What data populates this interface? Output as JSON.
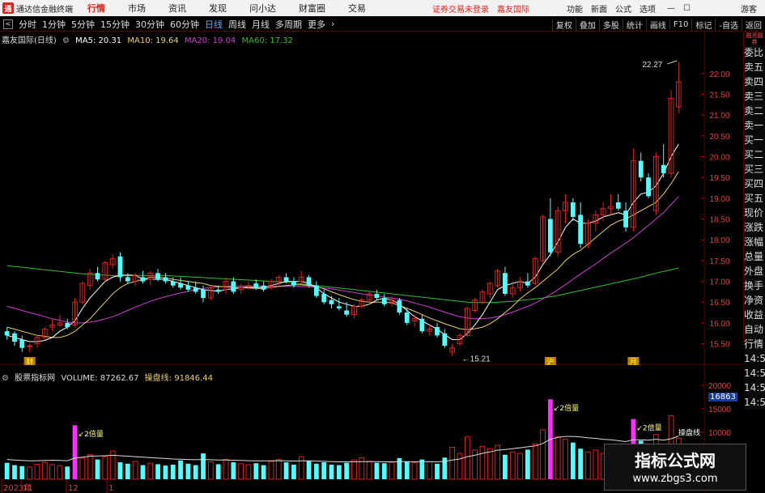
{
  "menubar": {
    "logo_text": "通",
    "app_title": "通达信金融终端",
    "menus": [
      "行情",
      "市场",
      "资讯",
      "发现",
      "问小达",
      "财富圈",
      "交易"
    ],
    "active_menu": "行情",
    "notice": "证券交易未登录",
    "stock_label": "嘉友国际",
    "right_menus": [
      "功能",
      "新面",
      "公式",
      "选项"
    ],
    "guest": "游客"
  },
  "toolbar": {
    "periods": [
      "分时",
      "1分钟",
      "5分钟",
      "15分钟",
      "30分钟",
      "60分钟",
      "日线",
      "周线",
      "月线",
      "多周期",
      "更多"
    ],
    "active_period": "日线",
    "right_buttons": [
      "复权",
      "叠加",
      "多股",
      "统计",
      "画线",
      "F10",
      "标记",
      "-自选",
      "返回"
    ]
  },
  "info": {
    "stock": "嘉友国际(日线)",
    "ma5": "MA5: 20.31",
    "ma10": "MA10: 19.64",
    "ma20": "MA20: 19.04",
    "ma60": "MA60: 17.32"
  },
  "colors": {
    "up": "#e02020",
    "down": "#54ffff",
    "ma5": "#ffffff",
    "ma10": "#e8d070",
    "ma20": "#d040d0",
    "ma60": "#30c030"
  },
  "price_axis": {
    "ticks": [
      "22.00",
      "21.50",
      "21.00",
      "20.50",
      "20.00",
      "19.50",
      "19.00",
      "18.50",
      "18.00",
      "17.50",
      "17.00",
      "16.50",
      "16.00",
      "15.50"
    ]
  },
  "annotations": {
    "high": "22.27",
    "low": "15.21",
    "marker_cai": "财",
    "marker_hu": "沪",
    "marker_yue": "月"
  },
  "side_panel": {
    "top_note": "融资融券",
    "items": [
      "委比",
      "卖五",
      "卖四",
      "卖三",
      "卖二",
      "卖一",
      "买一",
      "买二",
      "买三",
      "买四",
      "买五",
      "现价",
      "涨跌",
      "涨幅",
      "总量",
      "外盘",
      "换手",
      "净资",
      "收益",
      "自动",
      "行情",
      "14:5",
      "14:5",
      "14:5",
      "14:5"
    ]
  },
  "volume": {
    "indicator": "股票指标网",
    "volume": "VOLUME: 87262.67",
    "line": "操盘线: 91846.44",
    "current": "16863",
    "ticks": [
      "20000",
      "15000",
      "10000"
    ],
    "label_2x": "2倍量",
    "label_op": "操盘线"
  },
  "date_axis": {
    "labels": [
      "2023年",
      "11",
      "12",
      "1"
    ]
  },
  "watermark": {
    "line1": "指标公式网",
    "line2": "www.zbgs3.com"
  },
  "chart_data": {
    "type": "candlestick",
    "ylim": [
      15.2,
      22.6
    ],
    "candles": [
      [
        15.8,
        15.9,
        15.6,
        15.7
      ],
      [
        15.75,
        15.8,
        15.45,
        15.55
      ],
      [
        15.6,
        15.7,
        15.3,
        15.4
      ],
      [
        15.45,
        15.5,
        15.3,
        15.45
      ],
      [
        15.5,
        15.7,
        15.4,
        15.65
      ],
      [
        15.65,
        15.9,
        15.6,
        15.85
      ],
      [
        15.9,
        16.1,
        15.8,
        15.95
      ],
      [
        15.95,
        16.2,
        15.9,
        16.0
      ],
      [
        16.0,
        16.1,
        15.85,
        15.9
      ],
      [
        15.95,
        16.6,
        15.9,
        16.5
      ],
      [
        16.5,
        17.0,
        16.45,
        16.95
      ],
      [
        16.9,
        17.3,
        16.8,
        17.2
      ],
      [
        17.2,
        17.35,
        17.0,
        17.05
      ],
      [
        17.05,
        17.5,
        17.0,
        17.45
      ],
      [
        17.4,
        17.65,
        17.3,
        17.55
      ],
      [
        17.6,
        17.7,
        17.0,
        17.1
      ],
      [
        17.1,
        17.2,
        16.95,
        17.0
      ],
      [
        17.0,
        17.2,
        16.9,
        17.15
      ],
      [
        17.1,
        17.25,
        16.95,
        17.0
      ],
      [
        17.05,
        17.25,
        16.9,
        17.2
      ],
      [
        17.2,
        17.3,
        17.0,
        17.05
      ],
      [
        17.1,
        17.2,
        16.95,
        17.0
      ],
      [
        17.0,
        17.1,
        16.85,
        16.9
      ],
      [
        16.95,
        17.1,
        16.8,
        16.85
      ],
      [
        16.9,
        17.0,
        16.75,
        16.8
      ],
      [
        16.85,
        17.0,
        16.7,
        16.75
      ],
      [
        16.8,
        16.9,
        16.5,
        16.6
      ],
      [
        16.6,
        16.9,
        16.55,
        16.85
      ],
      [
        16.8,
        16.9,
        16.7,
        16.75
      ],
      [
        16.8,
        17.1,
        16.7,
        17.0
      ],
      [
        17.0,
        17.1,
        16.7,
        16.75
      ],
      [
        16.8,
        16.95,
        16.7,
        16.85
      ],
      [
        16.9,
        17.0,
        16.8,
        16.9
      ],
      [
        16.95,
        17.05,
        16.8,
        16.85
      ],
      [
        16.9,
        17.0,
        16.75,
        16.8
      ],
      [
        16.85,
        17.05,
        16.8,
        17.0
      ],
      [
        17.0,
        17.15,
        16.9,
        17.1
      ],
      [
        17.1,
        17.2,
        16.95,
        17.0
      ],
      [
        17.0,
        17.1,
        16.85,
        16.9
      ],
      [
        17.0,
        17.25,
        16.95,
        17.1
      ],
      [
        17.1,
        17.15,
        16.85,
        16.9
      ],
      [
        16.9,
        17.0,
        16.6,
        16.65
      ],
      [
        16.7,
        16.8,
        16.45,
        16.5
      ],
      [
        16.55,
        16.65,
        16.35,
        16.45
      ],
      [
        16.4,
        16.6,
        16.3,
        16.35
      ],
      [
        16.3,
        16.5,
        16.15,
        16.2
      ],
      [
        16.2,
        16.45,
        16.1,
        16.4
      ],
      [
        16.4,
        16.6,
        16.35,
        16.55
      ],
      [
        16.55,
        16.75,
        16.5,
        16.7
      ],
      [
        16.7,
        16.8,
        16.55,
        16.6
      ],
      [
        16.6,
        16.7,
        16.4,
        16.45
      ],
      [
        16.5,
        16.65,
        16.4,
        16.55
      ],
      [
        16.55,
        16.6,
        16.2,
        16.25
      ],
      [
        16.25,
        16.35,
        15.95,
        16.0
      ],
      [
        16.05,
        16.2,
        15.9,
        16.1
      ],
      [
        16.1,
        16.2,
        15.75,
        15.8
      ],
      [
        15.8,
        15.95,
        15.7,
        15.85
      ],
      [
        15.9,
        16.0,
        15.65,
        15.7
      ],
      [
        15.75,
        15.85,
        15.4,
        15.45
      ],
      [
        15.3,
        15.5,
        15.21,
        15.4
      ],
      [
        15.5,
        15.75,
        15.45,
        15.7
      ],
      [
        15.7,
        16.4,
        15.65,
        16.35
      ],
      [
        16.3,
        16.6,
        16.25,
        16.55
      ],
      [
        16.5,
        16.8,
        16.45,
        16.75
      ],
      [
        16.7,
        17.0,
        16.6,
        16.95
      ],
      [
        16.9,
        17.3,
        16.85,
        17.25
      ],
      [
        17.2,
        17.35,
        16.65,
        16.7
      ],
      [
        16.7,
        17.0,
        16.6,
        16.85
      ],
      [
        16.85,
        17.1,
        16.75,
        17.0
      ],
      [
        17.0,
        17.2,
        16.85,
        16.9
      ],
      [
        16.95,
        17.6,
        16.9,
        17.55
      ],
      [
        17.5,
        18.6,
        17.45,
        18.55
      ],
      [
        18.5,
        19.0,
        17.6,
        17.7
      ],
      [
        17.7,
        18.8,
        17.6,
        18.7
      ],
      [
        18.7,
        19.1,
        18.4,
        18.9
      ],
      [
        18.9,
        19.0,
        18.45,
        18.55
      ],
      [
        18.6,
        18.9,
        17.8,
        17.9
      ],
      [
        17.9,
        18.5,
        17.8,
        18.4
      ],
      [
        18.4,
        18.7,
        18.2,
        18.6
      ],
      [
        18.6,
        18.9,
        18.45,
        18.75
      ],
      [
        18.75,
        19.1,
        18.6,
        18.8
      ],
      [
        18.9,
        19.1,
        18.7,
        18.75
      ],
      [
        18.7,
        18.9,
        18.2,
        18.3
      ],
      [
        18.3,
        20.2,
        18.2,
        19.9
      ],
      [
        19.9,
        20.1,
        19.4,
        19.5
      ],
      [
        19.5,
        19.6,
        19.0,
        19.05
      ],
      [
        18.7,
        20.1,
        18.6,
        20.0
      ],
      [
        19.8,
        20.3,
        19.5,
        19.6
      ],
      [
        19.6,
        21.6,
        19.5,
        21.4
      ],
      [
        21.2,
        22.27,
        21.05,
        21.8
      ]
    ],
    "ma5": [
      15.7,
      15.65,
      15.6,
      15.55,
      15.55,
      15.58,
      15.65,
      15.8,
      15.9,
      16.05,
      16.35,
      16.6,
      16.8,
      17.0,
      17.1,
      17.15,
      17.15,
      17.15,
      17.05,
      17.05,
      17.05,
      17.05,
      17.0,
      16.95,
      16.9,
      16.85,
      16.8,
      16.78,
      16.76,
      16.8,
      16.82,
      16.85,
      16.86,
      16.85,
      16.85,
      16.9,
      16.95,
      17.0,
      17.0,
      17.0,
      16.95,
      16.85,
      16.7,
      16.6,
      16.5,
      16.45,
      16.4,
      16.4,
      16.45,
      16.55,
      16.6,
      16.55,
      16.45,
      16.3,
      16.15,
      16.05,
      15.95,
      15.85,
      15.72,
      15.6,
      15.6,
      15.75,
      15.95,
      16.2,
      16.5,
      16.8,
      16.9,
      16.95,
      17.0,
      16.95,
      17.1,
      17.4,
      17.65,
      17.95,
      18.3,
      18.5,
      18.4,
      18.4,
      18.45,
      18.55,
      18.6,
      18.65,
      18.6,
      18.9,
      19.1,
      19.15,
      19.3,
      19.6,
      20.0,
      20.3
    ],
    "ma10": [
      15.9,
      15.85,
      15.8,
      15.75,
      15.7,
      15.68,
      15.65,
      15.65,
      15.7,
      15.8,
      15.95,
      16.1,
      16.3,
      16.5,
      16.7,
      16.85,
      16.95,
      17.0,
      17.05,
      17.1,
      17.1,
      17.08,
      17.05,
      17.02,
      17.0,
      16.97,
      16.95,
      16.9,
      16.88,
      16.87,
      16.85,
      16.85,
      16.84,
      16.83,
      16.83,
      16.85,
      16.88,
      16.9,
      16.92,
      16.92,
      16.9,
      16.88,
      16.82,
      16.75,
      16.68,
      16.62,
      16.56,
      16.52,
      16.5,
      16.5,
      16.5,
      16.48,
      16.42,
      16.35,
      16.28,
      16.2,
      16.12,
      16.05,
      15.98,
      15.92,
      15.86,
      15.84,
      15.86,
      15.9,
      15.98,
      16.1,
      16.25,
      16.4,
      16.58,
      16.72,
      16.85,
      17.0,
      17.15,
      17.3,
      17.5,
      17.65,
      17.75,
      17.9,
      18.05,
      18.2,
      18.35,
      18.45,
      18.5,
      18.6,
      18.7,
      18.8,
      18.9,
      19.1,
      19.35,
      19.64
    ],
    "ma20": [
      16.4,
      16.35,
      16.3,
      16.25,
      16.2,
      16.15,
      16.1,
      16.06,
      16.02,
      16.0,
      16.0,
      16.02,
      16.05,
      16.1,
      16.15,
      16.22,
      16.3,
      16.38,
      16.45,
      16.52,
      16.58,
      16.63,
      16.68,
      16.72,
      16.76,
      16.8,
      16.83,
      16.85,
      16.87,
      16.88,
      16.89,
      16.89,
      16.89,
      16.89,
      16.88,
      16.88,
      16.88,
      16.88,
      16.88,
      16.88,
      16.87,
      16.86,
      16.84,
      16.82,
      16.79,
      16.76,
      16.73,
      16.7,
      16.67,
      16.65,
      16.62,
      16.6,
      16.57,
      16.53,
      16.48,
      16.43,
      16.38,
      16.32,
      16.26,
      16.2,
      16.15,
      16.12,
      16.1,
      16.1,
      16.12,
      16.15,
      16.2,
      16.26,
      16.33,
      16.4,
      16.48,
      16.58,
      16.68,
      16.8,
      16.92,
      17.05,
      17.18,
      17.3,
      17.42,
      17.55,
      17.68,
      17.8,
      17.92,
      18.05,
      18.2,
      18.35,
      18.5,
      18.65,
      18.85,
      19.04
    ],
    "ma60": [
      17.38,
      17.36,
      17.34,
      17.32,
      17.3,
      17.28,
      17.26,
      17.24,
      17.22,
      17.2,
      17.18,
      17.17,
      17.16,
      17.15,
      17.14,
      17.14,
      17.14,
      17.14,
      17.14,
      17.14,
      17.14,
      17.14,
      17.13,
      17.12,
      17.11,
      17.1,
      17.09,
      17.08,
      17.07,
      17.06,
      17.05,
      17.04,
      17.03,
      17.02,
      17.01,
      17.0,
      16.99,
      16.98,
      16.96,
      16.94,
      16.92,
      16.9,
      16.88,
      16.86,
      16.84,
      16.82,
      16.8,
      16.78,
      16.76,
      16.74,
      16.72,
      16.7,
      16.68,
      16.66,
      16.64,
      16.62,
      16.6,
      16.58,
      16.56,
      16.54,
      16.52,
      16.5,
      16.49,
      16.49,
      16.49,
      16.5,
      16.51,
      16.52,
      16.54,
      16.56,
      16.58,
      16.6,
      16.63,
      16.66,
      16.7,
      16.74,
      16.78,
      16.82,
      16.86,
      16.9,
      16.94,
      16.98,
      17.02,
      17.06,
      17.1,
      17.15,
      17.2,
      17.24,
      17.28,
      17.32
    ],
    "volumes": [
      3500,
      3000,
      2800,
      2600,
      3200,
      3600,
      3100,
      2900,
      2700,
      11500,
      4500,
      5200,
      4200,
      4800,
      6000,
      3600,
      3300,
      3800,
      3000,
      3400,
      3200,
      2900,
      3100,
      4000,
      3300,
      3000,
      5500,
      3700,
      3200,
      4200,
      3600,
      3300,
      3100,
      3400,
      3000,
      3800,
      4200,
      3600,
      3100,
      4800,
      3900,
      3300,
      3600,
      3100,
      3000,
      3500,
      4100,
      4600,
      3800,
      3500,
      3400,
      3600,
      4500,
      3800,
      3500,
      4200,
      3700,
      3300,
      4600,
      6800,
      5500,
      9000,
      6200,
      7000,
      6500,
      7200,
      5200,
      5800,
      5500,
      6300,
      7500,
      10500,
      17000,
      9000,
      8500,
      7800,
      6500,
      5800,
      6200,
      5500,
      5700,
      5200,
      5000,
      12800,
      8200,
      7100,
      9500,
      6800,
      13500,
      8726
    ],
    "vol_line": [
      4200,
      4100,
      4000,
      3900,
      3950,
      4000,
      4050,
      4000,
      3950,
      4500,
      4700,
      4900,
      4950,
      5000,
      5100,
      5000,
      4900,
      4800,
      4700,
      4600,
      4500,
      4400,
      4300,
      4250,
      4200,
      4150,
      4200,
      4150,
      4100,
      4100,
      4050,
      4000,
      3950,
      3900,
      3900,
      3900,
      3950,
      3900,
      3850,
      3900,
      3900,
      3850,
      3800,
      3750,
      3700,
      3700,
      3700,
      3750,
      3750,
      3750,
      3700,
      3700,
      3750,
      3750,
      3700,
      3750,
      3750,
      3700,
      3800,
      4100,
      4300,
      4800,
      5100,
      5500,
      5800,
      6200,
      6300,
      6500,
      6700,
      6900,
      7100,
      7600,
      8500,
      8900,
      9100,
      9100,
      9000,
      8800,
      8700,
      8500,
      8400,
      8200,
      8000,
      8400,
      8400,
      8300,
      8500,
      8300,
      8600,
      9185
    ],
    "marker_2x_indices": [
      9,
      72,
      83
    ],
    "volume_ylim": [
      0,
      21000
    ]
  }
}
